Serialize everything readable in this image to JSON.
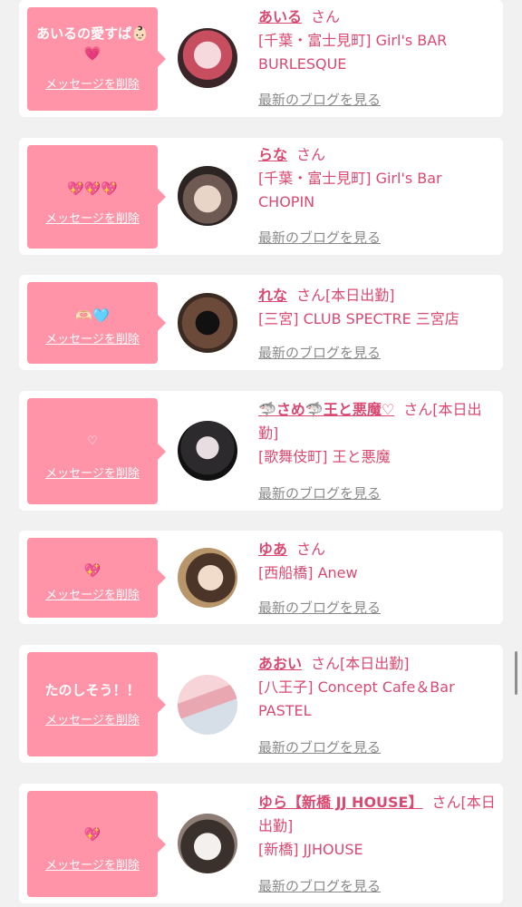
{
  "messages": [
    {
      "message": "あいるの愛すぱ👶🏻💗",
      "delete_label": "メッセージを削除",
      "name": "あいる",
      "honorific": "さん",
      "status": "",
      "shop_line1": "[千葉・富士見町] Girl's BAR",
      "shop_line2": "BURLESQUE",
      "blog_label": "最新のブログを見る"
    },
    {
      "message": "💖💖💖",
      "delete_label": "メッセージを削除",
      "name": "らな",
      "honorific": "さん",
      "status": "",
      "shop_line1": "[千葉・富士見町] Girl's Bar",
      "shop_line2": "CHOPIN",
      "blog_label": "最新のブログを見る"
    },
    {
      "message": "🫶🏻🩵",
      "delete_label": "メッセージを削除",
      "name": "れな",
      "honorific": "さん",
      "status": "[本日出勤]",
      "shop_line1": "[三宮] CLUB SPECTRE 三宮店",
      "shop_line2": "",
      "blog_label": "最新のブログを見る"
    },
    {
      "message": "♡",
      "delete_label": "メッセージを削除",
      "name": "🦈さめ🦈王と悪魔♡",
      "honorific": "さん",
      "status": "[本日出勤]",
      "shop_line1": "[歌舞伎町] 王と悪魔",
      "shop_line2": "",
      "blog_label": "最新のブログを見る"
    },
    {
      "message": "💖",
      "delete_label": "メッセージを削除",
      "name": "ゆあ",
      "honorific": "さん",
      "status": "",
      "shop_line1": "[西船橋] Anew",
      "shop_line2": "",
      "blog_label": "最新のブログを見る"
    },
    {
      "message": "たのしそう！！",
      "delete_label": "メッセージを削除",
      "name": "あおい",
      "honorific": "さん",
      "status": "[本日出勤]",
      "shop_line1": "[八王子] Concept Cafe＆Bar",
      "shop_line2": "PASTEL",
      "blog_label": "最新のブログを見る"
    },
    {
      "message": "💖",
      "delete_label": "メッセージを削除",
      "name": "ゆら【新橋 JJ HOUSE】",
      "honorific": "さん",
      "status": "[本日出勤]",
      "shop_line1": "[新橋] JJHOUSE",
      "shop_line2": "",
      "blog_label": "最新のブログを見る"
    }
  ],
  "colors": {
    "accent_pink": "#ff94a8",
    "name_pink": "#d84a72",
    "link_gray": "#8a8a8a",
    "background": "#f1f1f1"
  }
}
